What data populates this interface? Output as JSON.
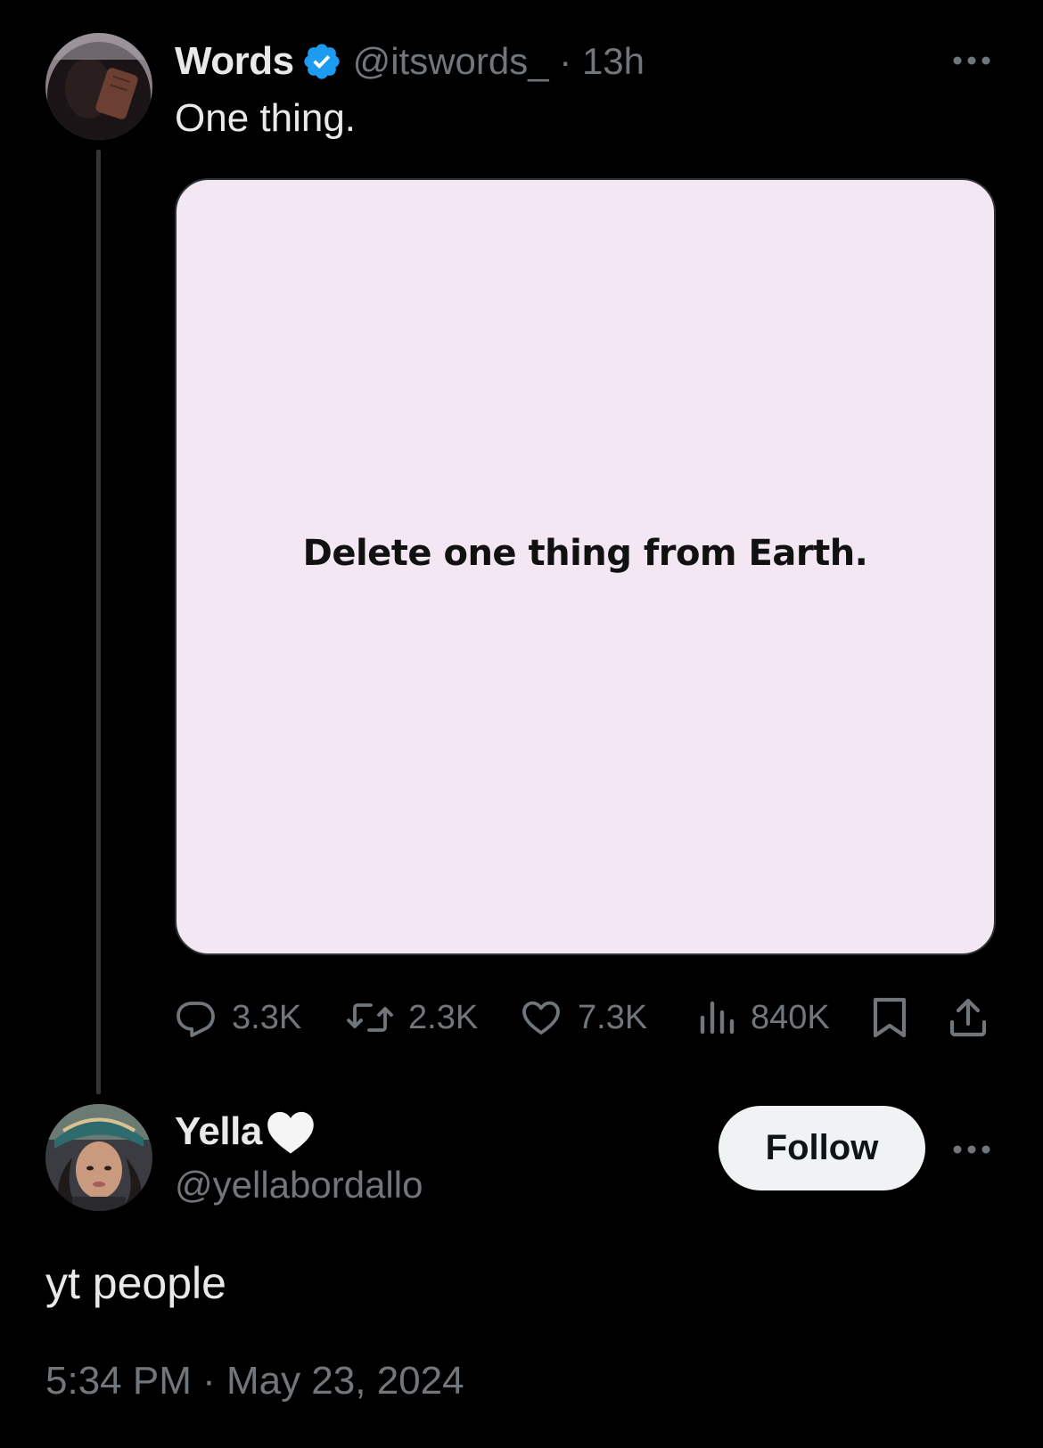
{
  "tweet": {
    "author_name": "Words",
    "verified": true,
    "handle_time": "@itswords_ · 13h",
    "text": "One thing.",
    "media_text": "Delete one thing from Earth.",
    "stats": {
      "replies": "3.3K",
      "reposts": "2.3K",
      "likes": "7.3K",
      "views": "840K"
    }
  },
  "reply": {
    "author_name": "Yella",
    "author_emoji": "heart-icon",
    "handle": "@yellabordallo",
    "follow_label": "Follow",
    "text": "yt people",
    "timestamp": "5:34 PM · May 23, 2024"
  },
  "colors": {
    "background": "#000000",
    "text_primary": "#e7e9ea",
    "text_secondary": "#71767b",
    "verified_blue": "#1d9bf0",
    "media_bg": "#f2e7f3",
    "follow_bg": "#eff3f4"
  }
}
